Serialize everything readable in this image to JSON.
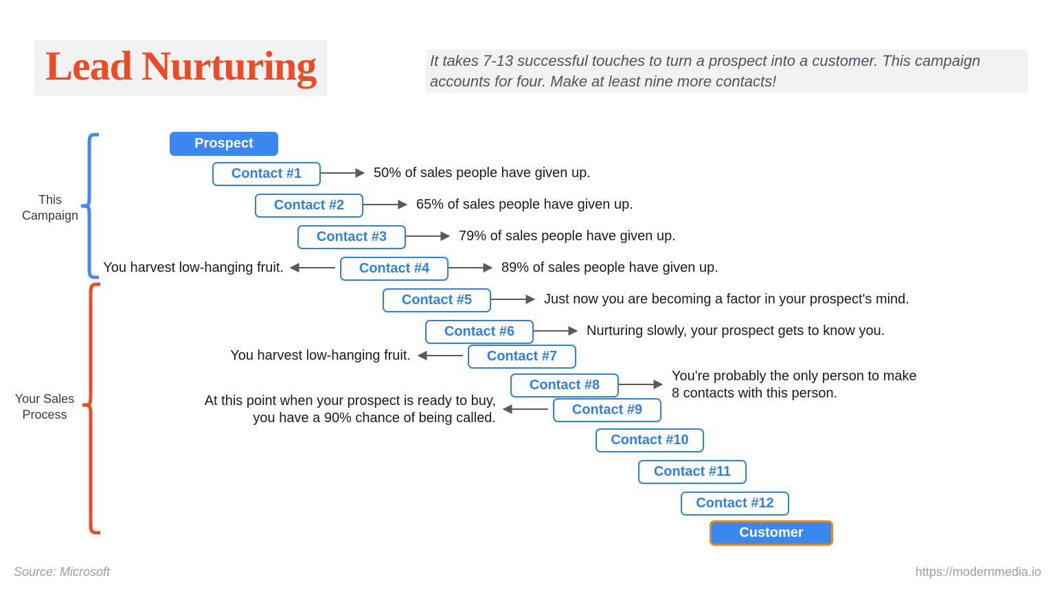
{
  "title": "Lead Nurturing",
  "subtitle": "It takes 7-13 successful touches to turn a prospect into a customer. This campaign accounts for four. Make at least nine more contacts!",
  "sections": {
    "campaign": "This Campaign",
    "process": "Your Sales Process"
  },
  "steps": {
    "prospect": "Prospect",
    "c1": "Contact #1",
    "c2": "Contact #2",
    "c3": "Contact #3",
    "c4": "Contact #4",
    "c5": "Contact #5",
    "c6": "Contact #6",
    "c7": "Contact #7",
    "c8": "Contact #8",
    "c9": "Contact #9",
    "c10": "Contact #10",
    "c11": "Contact #11",
    "c12": "Contact #12",
    "customer": "Customer"
  },
  "notes": {
    "c1": "50% of sales people have given up.",
    "c2": "65% of sales people have given up.",
    "c3": "79% of sales people have given up.",
    "c4": "89% of sales people have given up.",
    "c4_left": "You harvest low-hanging fruit.",
    "c5": "Just now you are becoming a factor in your prospect's mind.",
    "c6": "Nurturing slowly, your prospect gets to know you.",
    "c7_left": "You harvest low-hanging fruit.",
    "c8": "You're probably the only person to make 8 contacts with this person.",
    "c9_left": "At this point when your prospect is ready to buy, you have a 90% chance of being called."
  },
  "footer": {
    "source": "Source: Microsoft",
    "url": "https://modernmedia.io"
  }
}
